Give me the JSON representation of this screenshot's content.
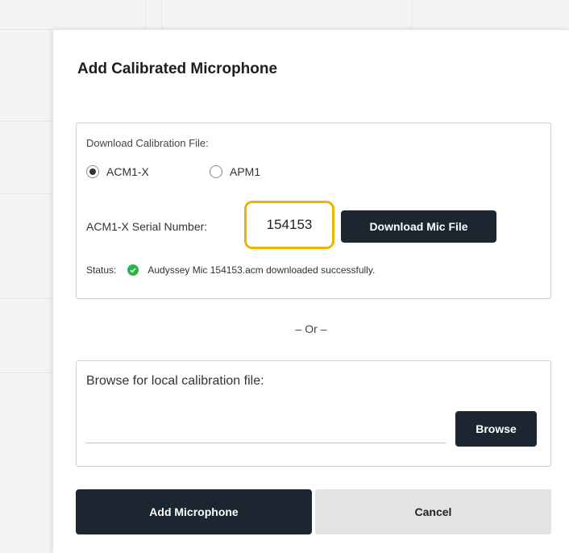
{
  "dialog": {
    "title": "Add Calibrated Microphone"
  },
  "download_section": {
    "label": "Download Calibration File:",
    "radio_options": [
      {
        "label": "ACM1-X",
        "selected": true
      },
      {
        "label": "APM1",
        "selected": false
      }
    ],
    "serial_label": "ACM1-X Serial Number:",
    "serial_value": "154153",
    "download_button": "Download Mic File",
    "status_label": "Status:",
    "status_text": "Audyssey Mic 154153.acm downloaded successfully.",
    "status_color": "#2bb34a",
    "highlight_color": "#f0b400"
  },
  "divider_text": "– Or –",
  "browse_section": {
    "label": "Browse for local calibration file:",
    "file_value": "",
    "browse_button": "Browse"
  },
  "actions": {
    "add_button": "Add Microphone",
    "cancel_button": "Cancel"
  },
  "colors": {
    "primary_button": "#1b2631",
    "secondary_button": "#e3e3e3"
  }
}
